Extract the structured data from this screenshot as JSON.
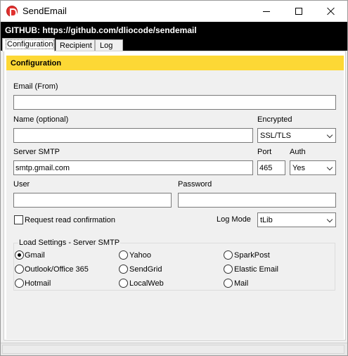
{
  "window": {
    "title": "SendEmail",
    "github_text": "GITHUB: https://github.com/dliocode/sendemail"
  },
  "tabs": [
    {
      "label": "Configuration",
      "active": true
    },
    {
      "label": "Recipient",
      "active": false
    },
    {
      "label": "Log",
      "active": false
    }
  ],
  "config": {
    "section_title": "Configuration",
    "email_from": {
      "label": "Email (From)",
      "value": ""
    },
    "name": {
      "label": "Name (optional)",
      "value": ""
    },
    "encrypted": {
      "label": "Encrypted",
      "value": "SSL/TLS"
    },
    "server_smtp": {
      "label": "Server SMTP",
      "value": "smtp.gmail.com"
    },
    "port": {
      "label": "Port",
      "value": "465"
    },
    "auth": {
      "label": "Auth",
      "value": "Yes"
    },
    "user": {
      "label": "User",
      "value": ""
    },
    "password": {
      "label": "Password",
      "value": ""
    },
    "read_confirmation": {
      "label": "Request read confirmation",
      "checked": false
    },
    "log_mode": {
      "label": "Log Mode",
      "value": "tLib"
    }
  },
  "load_settings": {
    "title": "Load Settings - Server SMTP",
    "options": [
      {
        "label": "Gmail",
        "checked": true
      },
      {
        "label": "Yahoo",
        "checked": false
      },
      {
        "label": "SparkPost",
        "checked": false
      },
      {
        "label": "Outlook/Office 365",
        "checked": false
      },
      {
        "label": "SendGrid",
        "checked": false
      },
      {
        "label": "Elastic Email",
        "checked": false
      },
      {
        "label": "Hotmail",
        "checked": false
      },
      {
        "label": "LocalWeb",
        "checked": false
      },
      {
        "label": "Mail",
        "checked": false
      }
    ]
  },
  "colors": {
    "section_header": "#fdd835",
    "github_bar": "#000000",
    "app_icon": "#e0312f"
  }
}
